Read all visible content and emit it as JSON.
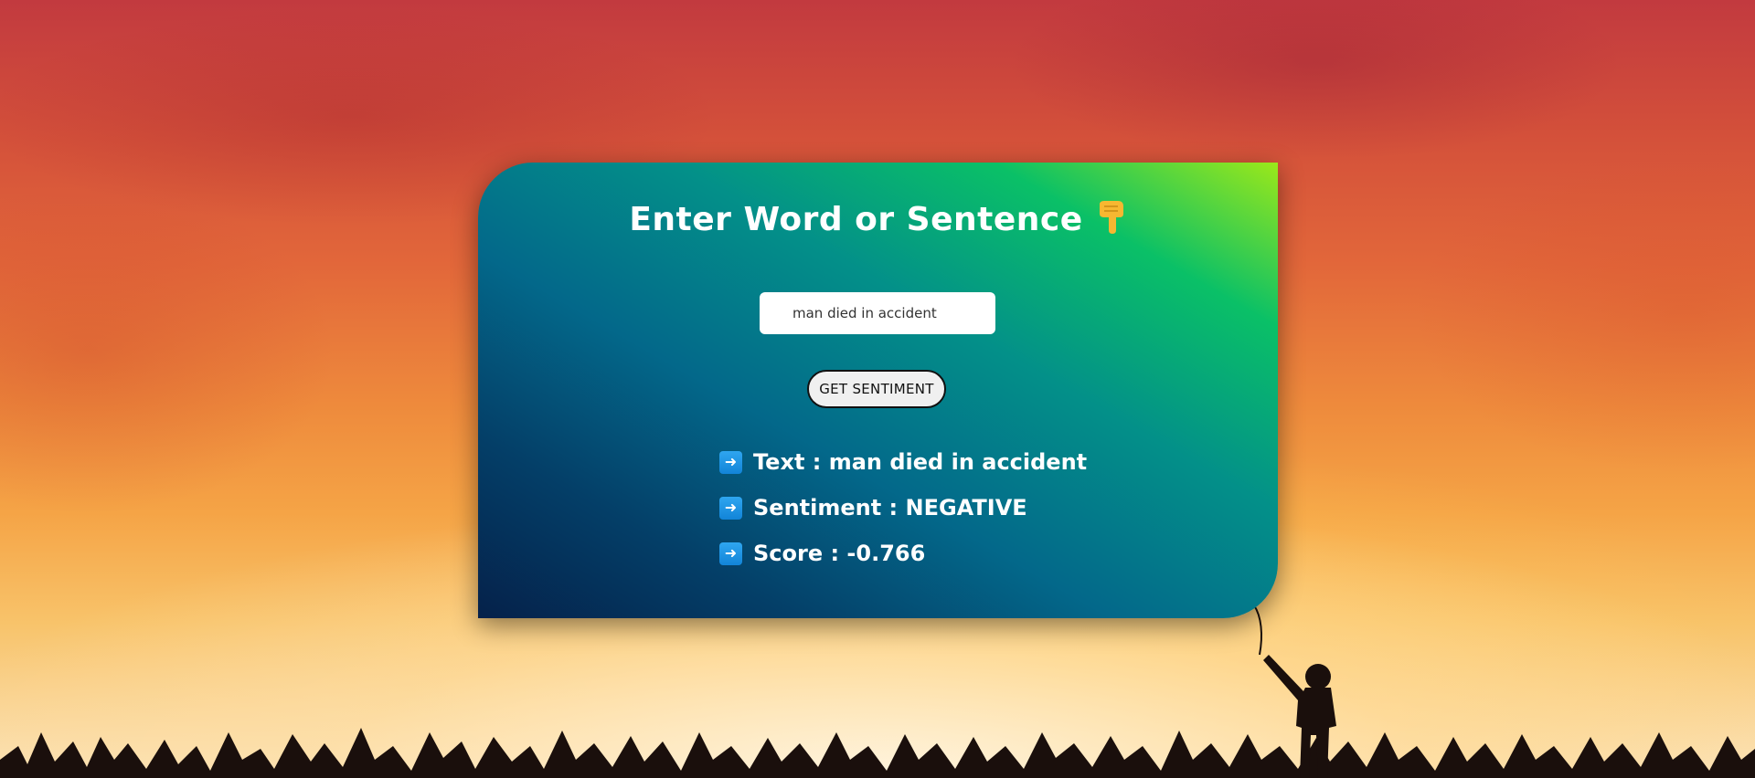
{
  "title": "Enter Word or Sentence",
  "title_icon": "pointing-down-hand-icon",
  "input": {
    "value": "man died in accident"
  },
  "button_label": "GET SENTIMENT",
  "results": {
    "arrow_icon": "right-arrow-icon",
    "text_line": "Text : man died in accident",
    "sentiment_line": "Sentiment : NEGATIVE",
    "score_line": "Score : -0.766"
  },
  "colors": {
    "card_gradient_start": "#9be81a",
    "card_gradient_end": "#05214a",
    "arrow_box": "#1e95e6",
    "hand_emoji": "#f7b731",
    "background_top": "#c23a3f",
    "background_bottom": "#fbe3b8"
  }
}
